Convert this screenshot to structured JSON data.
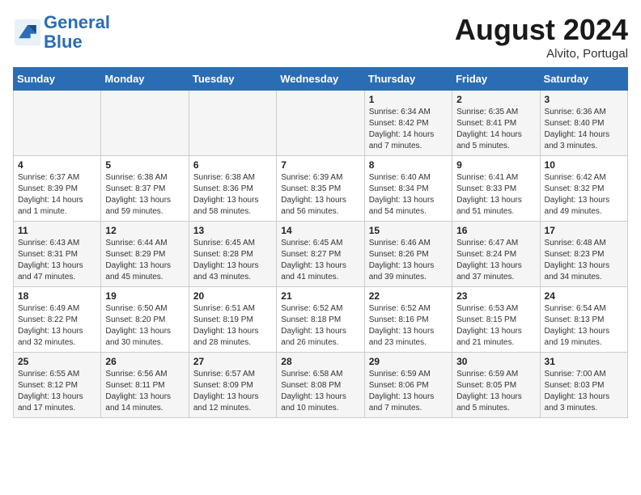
{
  "header": {
    "logo_line1": "General",
    "logo_line2": "Blue",
    "month_year": "August 2024",
    "location": "Alvito, Portugal"
  },
  "days_of_week": [
    "Sunday",
    "Monday",
    "Tuesday",
    "Wednesday",
    "Thursday",
    "Friday",
    "Saturday"
  ],
  "weeks": [
    [
      {
        "day": "",
        "info": ""
      },
      {
        "day": "",
        "info": ""
      },
      {
        "day": "",
        "info": ""
      },
      {
        "day": "",
        "info": ""
      },
      {
        "day": "1",
        "info": "Sunrise: 6:34 AM\nSunset: 8:42 PM\nDaylight: 14 hours\nand 7 minutes."
      },
      {
        "day": "2",
        "info": "Sunrise: 6:35 AM\nSunset: 8:41 PM\nDaylight: 14 hours\nand 5 minutes."
      },
      {
        "day": "3",
        "info": "Sunrise: 6:36 AM\nSunset: 8:40 PM\nDaylight: 14 hours\nand 3 minutes."
      }
    ],
    [
      {
        "day": "4",
        "info": "Sunrise: 6:37 AM\nSunset: 8:39 PM\nDaylight: 14 hours\nand 1 minute."
      },
      {
        "day": "5",
        "info": "Sunrise: 6:38 AM\nSunset: 8:37 PM\nDaylight: 13 hours\nand 59 minutes."
      },
      {
        "day": "6",
        "info": "Sunrise: 6:38 AM\nSunset: 8:36 PM\nDaylight: 13 hours\nand 58 minutes."
      },
      {
        "day": "7",
        "info": "Sunrise: 6:39 AM\nSunset: 8:35 PM\nDaylight: 13 hours\nand 56 minutes."
      },
      {
        "day": "8",
        "info": "Sunrise: 6:40 AM\nSunset: 8:34 PM\nDaylight: 13 hours\nand 54 minutes."
      },
      {
        "day": "9",
        "info": "Sunrise: 6:41 AM\nSunset: 8:33 PM\nDaylight: 13 hours\nand 51 minutes."
      },
      {
        "day": "10",
        "info": "Sunrise: 6:42 AM\nSunset: 8:32 PM\nDaylight: 13 hours\nand 49 minutes."
      }
    ],
    [
      {
        "day": "11",
        "info": "Sunrise: 6:43 AM\nSunset: 8:31 PM\nDaylight: 13 hours\nand 47 minutes."
      },
      {
        "day": "12",
        "info": "Sunrise: 6:44 AM\nSunset: 8:29 PM\nDaylight: 13 hours\nand 45 minutes."
      },
      {
        "day": "13",
        "info": "Sunrise: 6:45 AM\nSunset: 8:28 PM\nDaylight: 13 hours\nand 43 minutes."
      },
      {
        "day": "14",
        "info": "Sunrise: 6:45 AM\nSunset: 8:27 PM\nDaylight: 13 hours\nand 41 minutes."
      },
      {
        "day": "15",
        "info": "Sunrise: 6:46 AM\nSunset: 8:26 PM\nDaylight: 13 hours\nand 39 minutes."
      },
      {
        "day": "16",
        "info": "Sunrise: 6:47 AM\nSunset: 8:24 PM\nDaylight: 13 hours\nand 37 minutes."
      },
      {
        "day": "17",
        "info": "Sunrise: 6:48 AM\nSunset: 8:23 PM\nDaylight: 13 hours\nand 34 minutes."
      }
    ],
    [
      {
        "day": "18",
        "info": "Sunrise: 6:49 AM\nSunset: 8:22 PM\nDaylight: 13 hours\nand 32 minutes."
      },
      {
        "day": "19",
        "info": "Sunrise: 6:50 AM\nSunset: 8:20 PM\nDaylight: 13 hours\nand 30 minutes."
      },
      {
        "day": "20",
        "info": "Sunrise: 6:51 AM\nSunset: 8:19 PM\nDaylight: 13 hours\nand 28 minutes."
      },
      {
        "day": "21",
        "info": "Sunrise: 6:52 AM\nSunset: 8:18 PM\nDaylight: 13 hours\nand 26 minutes."
      },
      {
        "day": "22",
        "info": "Sunrise: 6:52 AM\nSunset: 8:16 PM\nDaylight: 13 hours\nand 23 minutes."
      },
      {
        "day": "23",
        "info": "Sunrise: 6:53 AM\nSunset: 8:15 PM\nDaylight: 13 hours\nand 21 minutes."
      },
      {
        "day": "24",
        "info": "Sunrise: 6:54 AM\nSunset: 8:13 PM\nDaylight: 13 hours\nand 19 minutes."
      }
    ],
    [
      {
        "day": "25",
        "info": "Sunrise: 6:55 AM\nSunset: 8:12 PM\nDaylight: 13 hours\nand 17 minutes."
      },
      {
        "day": "26",
        "info": "Sunrise: 6:56 AM\nSunset: 8:11 PM\nDaylight: 13 hours\nand 14 minutes."
      },
      {
        "day": "27",
        "info": "Sunrise: 6:57 AM\nSunset: 8:09 PM\nDaylight: 13 hours\nand 12 minutes."
      },
      {
        "day": "28",
        "info": "Sunrise: 6:58 AM\nSunset: 8:08 PM\nDaylight: 13 hours\nand 10 minutes."
      },
      {
        "day": "29",
        "info": "Sunrise: 6:59 AM\nSunset: 8:06 PM\nDaylight: 13 hours\nand 7 minutes."
      },
      {
        "day": "30",
        "info": "Sunrise: 6:59 AM\nSunset: 8:05 PM\nDaylight: 13 hours\nand 5 minutes."
      },
      {
        "day": "31",
        "info": "Sunrise: 7:00 AM\nSunset: 8:03 PM\nDaylight: 13 hours\nand 3 minutes."
      }
    ]
  ]
}
